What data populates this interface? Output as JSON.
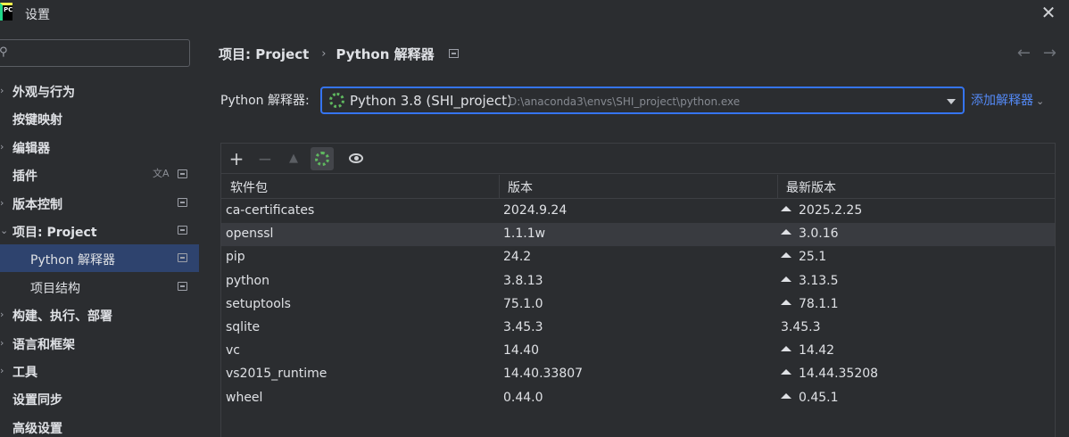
{
  "window": {
    "title": "设置",
    "app_icon_text": "PC",
    "close_icon": "close-icon"
  },
  "sidebar": {
    "search_placeholder": "",
    "items": [
      {
        "label": "外观与行为",
        "expandable": true,
        "expanded": false
      },
      {
        "label": "按键映射",
        "expandable": false
      },
      {
        "label": "编辑器",
        "expandable": true,
        "expanded": false
      },
      {
        "label": "插件",
        "expandable": false,
        "translate_icon": true,
        "badge": true
      },
      {
        "label": "版本控制",
        "expandable": true,
        "expanded": false,
        "badge": true
      },
      {
        "label": "项目: Project",
        "expandable": true,
        "expanded": true,
        "badge": true
      },
      {
        "label": "Python 解释器",
        "sub": true,
        "selected": true,
        "badge": true
      },
      {
        "label": "项目结构",
        "sub": true,
        "badge": true
      },
      {
        "label": "构建、执行、部署",
        "expandable": true,
        "expanded": false
      },
      {
        "label": "语言和框架",
        "expandable": true,
        "expanded": false
      },
      {
        "label": "工具",
        "expandable": true,
        "expanded": false
      },
      {
        "label": "设置同步",
        "expandable": false
      },
      {
        "label": "高级设置",
        "expandable": false
      }
    ]
  },
  "breadcrumb": {
    "parent": "项目: Project",
    "separator": "›",
    "current": "Python 解释器"
  },
  "interpreter": {
    "label": "Python 解释器:",
    "selected_name": "Python 3.8 (SHI_project)",
    "selected_path": "D:\\anaconda3\\envs\\SHI_project\\python.exe",
    "add_label": "添加解释器"
  },
  "toolbar": {
    "add": "+",
    "remove": "−",
    "upgrade": "▲"
  },
  "table": {
    "columns": [
      "软件包",
      "版本",
      "最新版本"
    ],
    "rows": [
      {
        "package": "ca-certificates",
        "version": "2024.9.24",
        "latest": "2025.2.25",
        "upgrade": true
      },
      {
        "package": "openssl",
        "version": "1.1.1w",
        "latest": "3.0.16",
        "upgrade": true
      },
      {
        "package": "pip",
        "version": "24.2",
        "latest": "25.1",
        "upgrade": true
      },
      {
        "package": "python",
        "version": "3.8.13",
        "latest": "3.13.5",
        "upgrade": true
      },
      {
        "package": "setuptools",
        "version": "75.1.0",
        "latest": "78.1.1",
        "upgrade": true
      },
      {
        "package": "sqlite",
        "version": "3.45.3",
        "latest": "3.45.3",
        "upgrade": false
      },
      {
        "package": "vc",
        "version": "14.40",
        "latest": "14.42",
        "upgrade": true
      },
      {
        "package": "vs2015_runtime",
        "version": "14.40.33807",
        "latest": "14.44.35208",
        "upgrade": true
      },
      {
        "package": "wheel",
        "version": "0.44.0",
        "latest": "0.45.1",
        "upgrade": true
      }
    ]
  },
  "colors": {
    "accent": "#3574f0",
    "link": "#548af7",
    "selected_bg": "#2e436e",
    "spinner": "#5fb85f"
  }
}
